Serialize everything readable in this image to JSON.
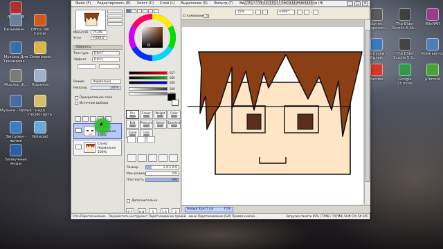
{
  "desktop": {
    "left_icons": [
      {
        "label": "Reader 9",
        "color": "#a83232"
      },
      {
        "label": "Безымянн...",
        "color": "#6b7f99"
      },
      {
        "label": "Office Tab Center",
        "color": "#cc5a1e"
      },
      {
        "label": "Музыка Для Тренировк...",
        "color": "#3b6ea5"
      },
      {
        "label": "Downloads",
        "color": "#d8b44a"
      },
      {
        "label": "Muzyka_di...",
        "color": "#7a7a7a"
      },
      {
        "label": "Корзина",
        "color": "#9fb2c8"
      },
      {
        "label": "Музыка - Ярлык",
        "color": "#4a6aa0"
      },
      {
        "label": "надо посмотреть",
        "color": "#d6c070"
      },
      {
        "label": "Загрузки - ярлык",
        "color": "#3d7bbf"
      },
      {
        "label": "Notepad",
        "color": "#6aa6d8"
      },
      {
        "label": "Безвучные моды",
        "color": "#2f5f9f"
      }
    ],
    "right_icons": [
      {
        "label": "Skyrim. ...ngenda...",
        "color": "#5a5a5a"
      },
      {
        "label": "The Elder Scrolls 5.Sk...",
        "color": "#3f3f3f"
      },
      {
        "label": "WinRAR",
        "color": "#9a3b8c"
      },
      {
        "label": "Загрузки - Ярлык",
        "color": "#3d7bbf"
      },
      {
        "label": "The Elder Scrolls 5.S...",
        "color": "#444"
      },
      {
        "label": "Компьютер",
        "color": "#4f7fb5"
      },
      {
        "label": "Yandex",
        "color": "#d23a2a"
      },
      {
        "label": "Google Chrome",
        "color": "#2f9a4a"
      },
      {
        "label": "µTorrent",
        "color": "#4aa33a"
      }
    ]
  },
  "watermark": "www.bandicam.com",
  "menubar": {
    "items": [
      "Файл (F)",
      "Редактировать (E)",
      "Холст (C)",
      "Слой (L)",
      "Выделение (S)",
      "Фильтр (T)",
      "Вид (V)",
      "Окна (W)",
      "Помощь/Настройки (H)"
    ]
  },
  "window_buttons": [
    "_",
    "□",
    "x"
  ],
  "toolbar": {
    "selection_label": "Выделение",
    "zoom": "75%",
    "angle": "+000°",
    "stabilizer_label": "Сглаживание",
    "stabilizer_value": "3"
  },
  "left_panel": {
    "zoom_label": "Масштаб",
    "zoom_value": "75,0%",
    "angle_label": "Угол",
    "angle_value": "+000,0",
    "effects_header": "Эффекты",
    "texture_label": "Текстура",
    "texture_value": "[Нет]",
    "effect_label": "Эффект",
    "effect_value": "[Нет]",
    "mode_label": "Режим",
    "mode_value": "Нормально",
    "opacity_label": "Непрозр.",
    "opacity_value": "100%",
    "clip_label": "Прикрепление слоя",
    "source_label": "Источник выбора",
    "layers": [
      {
        "name": "Слой1",
        "mode": "Нормально",
        "opacity": "100%",
        "selected": true
      },
      {
        "name": "Слой2",
        "mode": "Нормально",
        "opacity": "100%",
        "selected": false
      }
    ]
  },
  "tool_panel": {
    "rgb": {
      "r": "027",
      "g": "000",
      "b": "000"
    },
    "extra": {
      "a": "000",
      "s": "000"
    },
    "tools": [
      {
        "label": "Pen",
        "active": true
      },
      {
        "label": "Eraser",
        "active": false
      },
      {
        "label": "Weight",
        "active": false
      },
      {
        "label": "Color",
        "active": false
      },
      {
        "label": "Edit",
        "active": false
      },
      {
        "label": "Pressure",
        "active": false
      },
      {
        "label": "Select",
        "active": false
      },
      {
        "label": "Deselect",
        "active": false
      },
      {
        "label": "Curve",
        "active": false
      },
      {
        "label": "Line",
        "active": false
      }
    ],
    "size_label": "Размер",
    "size_mult": "x 0.1",
    "size_value": "6.0",
    "min_size_label": "Мин размер",
    "min_size_value": "0%",
    "density_label": "Плотность",
    "density_value": "100",
    "advanced_label": "Дополнительно",
    "brush_sizes": [
      "0.7",
      "0.8",
      "1",
      "1.5",
      "2"
    ]
  },
  "document": {
    "tab_name": "Новый Холст.sai",
    "tab_zoom": "75%"
  },
  "statusbar": {
    "text": "Ctrl+Перетаскивание - Переместить инструмент   Перетаскивание правой - меню Перетаскивание (SAI)   Правая кнопка...",
    "memory": "Загрузка памяти 69% (77MB / 747MB)   Shift Ctrl Alt SPC"
  },
  "colors": {
    "hair": "#8b3f14",
    "skin": "#fde5c6",
    "eyes": "#5a2e1b",
    "outline": "#111111"
  }
}
